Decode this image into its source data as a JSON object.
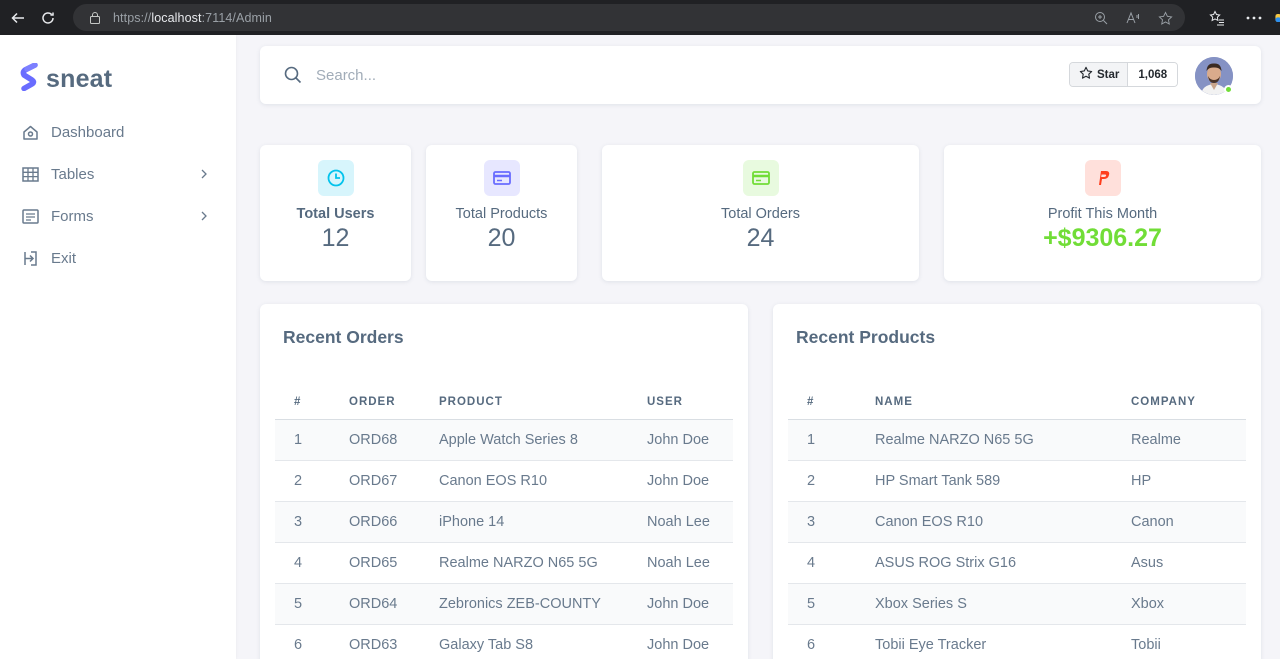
{
  "browser": {
    "url_scheme": "https://",
    "url_host": "localhost",
    "url_rest": ":7114/Admin"
  },
  "brand": {
    "name": "sneat",
    "color": "#696cff"
  },
  "sidebar": {
    "items": [
      {
        "label": "Dashboard",
        "icon": "home-icon",
        "has_submenu": false
      },
      {
        "label": "Tables",
        "icon": "table-icon",
        "has_submenu": true
      },
      {
        "label": "Forms",
        "icon": "form-icon",
        "has_submenu": true
      },
      {
        "label": "Exit",
        "icon": "exit-icon",
        "has_submenu": false
      }
    ]
  },
  "topnav": {
    "search_placeholder": "Search...",
    "star_label": "Star",
    "star_count": "1,068"
  },
  "stats": [
    {
      "label": "Total Users",
      "value": "12",
      "icon": "pie-clock-icon",
      "color": "#03c3ec"
    },
    {
      "label": "Total Products",
      "value": "20",
      "icon": "card-icon",
      "color": "#696cff"
    },
    {
      "label": "Total Orders",
      "value": "24",
      "icon": "credit-card-icon",
      "color": "#71dd37"
    },
    {
      "label": "Profit This Month",
      "value": "+$9306.27",
      "icon": "paypal-icon",
      "color": "#ff3e1d"
    }
  ],
  "recent_orders": {
    "title": "Recent Orders",
    "columns": [
      "#",
      "Order",
      "Product",
      "User"
    ],
    "rows": [
      [
        "1",
        "ORD68",
        "Apple Watch Series 8",
        "John Doe"
      ],
      [
        "2",
        "ORD67",
        "Canon EOS R10",
        "John Doe"
      ],
      [
        "3",
        "ORD66",
        "iPhone 14",
        "Noah Lee"
      ],
      [
        "4",
        "ORD65",
        "Realme NARZO N65 5G",
        "Noah Lee"
      ],
      [
        "5",
        "ORD64",
        "Zebronics ZEB-COUNTY",
        "John Doe"
      ],
      [
        "6",
        "ORD63",
        "Galaxy Tab S8",
        "John Doe"
      ]
    ]
  },
  "recent_products": {
    "title": "Recent Products",
    "columns": [
      "#",
      "Name",
      "Company"
    ],
    "rows": [
      [
        "1",
        "Realme NARZO N65 5G",
        "Realme"
      ],
      [
        "2",
        "HP Smart Tank 589",
        "HP"
      ],
      [
        "3",
        "Canon EOS R10",
        "Canon"
      ],
      [
        "4",
        "ASUS ROG Strix G16",
        "Asus"
      ],
      [
        "5",
        "Xbox Series S",
        "Xbox"
      ],
      [
        "6",
        "Tobii Eye Tracker",
        "Tobii"
      ]
    ]
  }
}
